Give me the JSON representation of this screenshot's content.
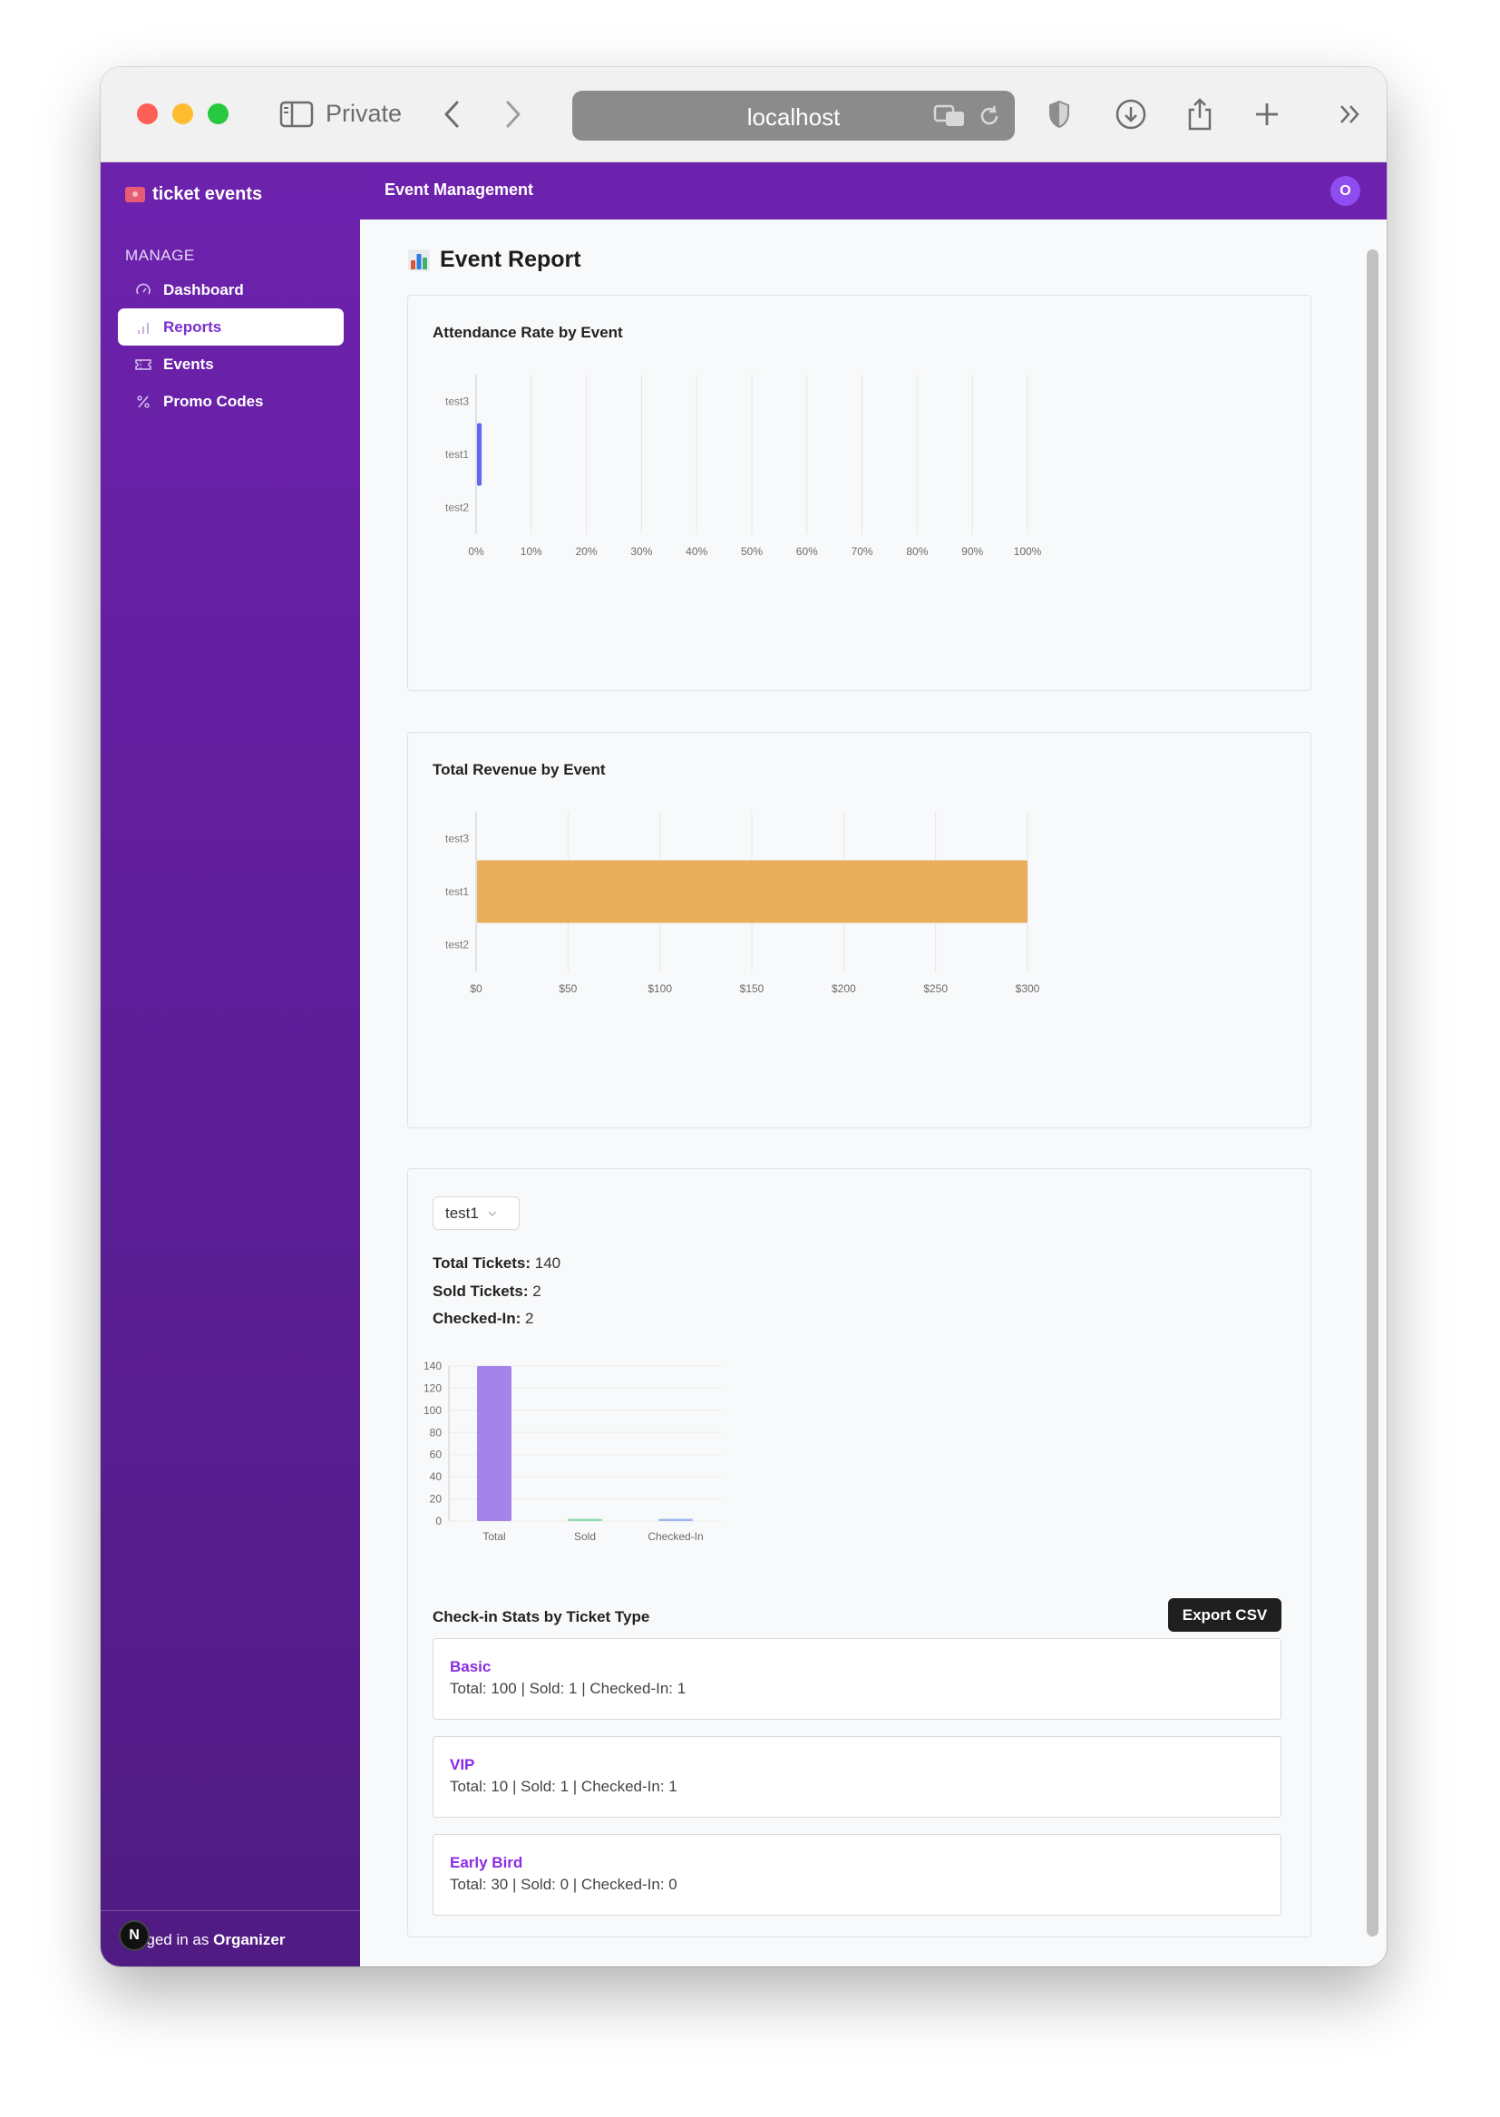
{
  "browser": {
    "mode_label": "Private",
    "url": "localhost"
  },
  "sidebar": {
    "brand": "ticket events",
    "section_label": "MANAGE",
    "items": [
      {
        "label": "Dashboard",
        "icon": "gauge-icon",
        "active": false
      },
      {
        "label": "Reports",
        "icon": "bar-chart-icon",
        "active": true
      },
      {
        "label": "Events",
        "icon": "ticket-icon",
        "active": false
      },
      {
        "label": "Promo Codes",
        "icon": "percent-icon",
        "active": false
      }
    ],
    "footer_prefix": "Logged in as",
    "footer_role": "Organizer",
    "footer_badge": "N"
  },
  "header": {
    "title": "Event Management",
    "avatar_initial": "O"
  },
  "page": {
    "title": "Event Report",
    "title_icon": "bar-chart-emoji-icon"
  },
  "chart_data": [
    {
      "type": "bar",
      "orientation": "horizontal",
      "title": "Attendance Rate by Event",
      "categories": [
        "test3",
        "test1",
        "test2"
      ],
      "values": [
        0,
        1,
        0
      ],
      "xlim": [
        0,
        100
      ],
      "x_ticks": [
        "0%",
        "10%",
        "20%",
        "30%",
        "40%",
        "50%",
        "60%",
        "70%",
        "80%",
        "90%",
        "100%"
      ],
      "color": "#6366f1",
      "grid": true
    },
    {
      "type": "bar",
      "orientation": "horizontal",
      "title": "Total Revenue by Event",
      "categories": [
        "test3",
        "test1",
        "test2"
      ],
      "values": [
        0,
        300,
        0
      ],
      "xlim": [
        0,
        300
      ],
      "x_ticks": [
        "$0",
        "$50",
        "$100",
        "$150",
        "$200",
        "$250",
        "$300"
      ],
      "color": "#e8ae5c",
      "grid": true
    },
    {
      "type": "bar",
      "orientation": "vertical",
      "categories": [
        "Total",
        "Sold",
        "Checked-In"
      ],
      "values": [
        140,
        2,
        2
      ],
      "ylim": [
        0,
        140
      ],
      "y_ticks": [
        "0",
        "20",
        "40",
        "60",
        "80",
        "100",
        "120",
        "140"
      ],
      "colors": [
        "#a584ea",
        "#8fd9ae",
        "#9bb8ee"
      ],
      "grid": true
    }
  ],
  "detail": {
    "selected_event": "test1",
    "total_label": "Total Tickets:",
    "total_value": "140",
    "sold_label": "Sold Tickets:",
    "sold_value": "2",
    "checked_label": "Checked-In:",
    "checked_value": "2",
    "checkin_title": "Check-in Stats by Ticket Type",
    "export_label": "Export CSV",
    "ticket_types": [
      {
        "name": "Basic",
        "detail": "Total: 100 | Sold: 1 | Checked-In: 1"
      },
      {
        "name": "VIP",
        "detail": "Total: 10 | Sold: 1 | Checked-In: 1"
      },
      {
        "name": "Early Bird",
        "detail": "Total: 30 | Sold: 0 | Checked-In: 0"
      }
    ]
  },
  "colors": {
    "brand_purple": "#6d22ad",
    "accent_purple": "#8a2be2"
  }
}
